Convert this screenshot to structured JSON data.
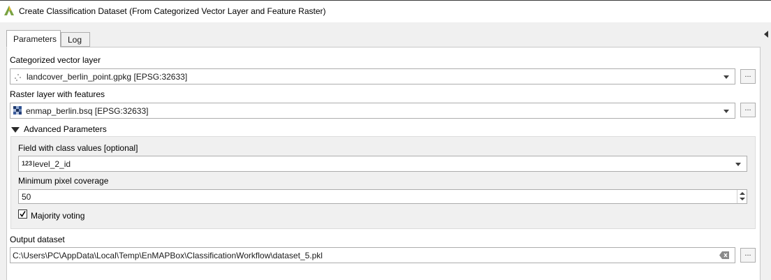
{
  "window": {
    "title": "Create Classification Dataset (From Categorized Vector Layer and Feature Raster)",
    "app_icon": "qgis-icon"
  },
  "tabs": [
    {
      "label": "Parameters",
      "active": true
    },
    {
      "label": "Log",
      "active": false
    }
  ],
  "params": {
    "vector_label": "Categorized vector layer",
    "vector_value": "landcover_berlin_point.gpkg [EPSG:32633]",
    "vector_icon": "point-layer-icon",
    "raster_label": "Raster layer with features",
    "raster_value": "enmap_berlin.bsq [EPSG:32633]",
    "raster_icon": "raster-layer-icon",
    "advanced_label": "Advanced Parameters",
    "class_field_label": "Field with class values [optional]",
    "class_field_type": "123",
    "class_field_value": "level_2_id",
    "coverage_label": "Minimum pixel coverage",
    "coverage_value": "50",
    "majority_label": "Majority voting",
    "majority_checked": true,
    "output_label": "Output dataset",
    "output_value": "C:\\Users\\PC\\AppData\\Local\\Temp\\EnMAPBox\\ClassificationWorkflow\\dataset_5.pkl",
    "dots": "..."
  },
  "colors": {
    "accent": "#3c78c8",
    "background": "#f0f0f0",
    "panel": "#ffffff"
  }
}
